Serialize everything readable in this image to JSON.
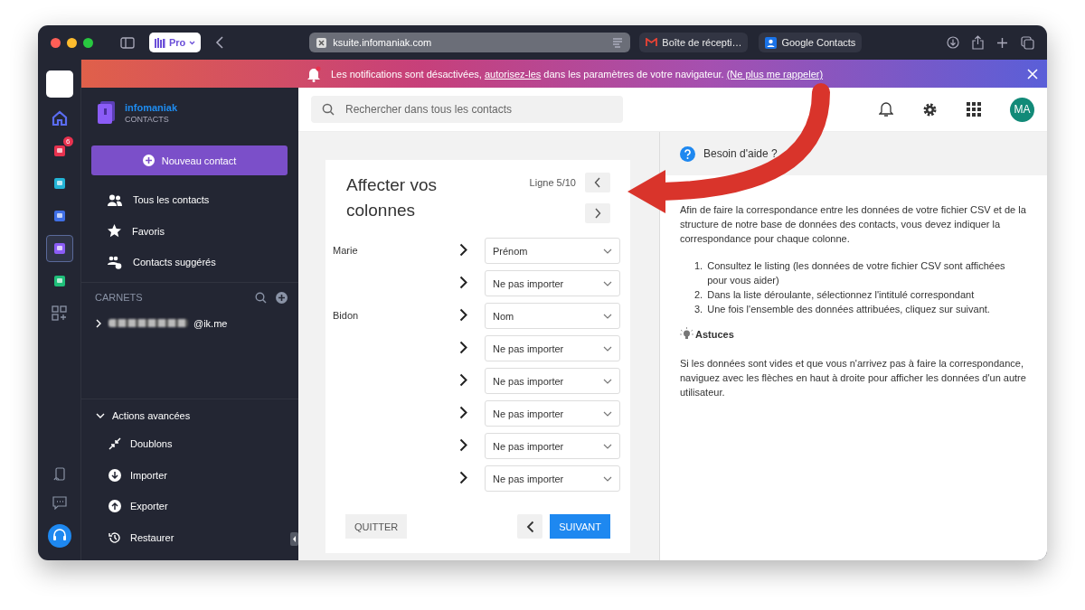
{
  "browser": {
    "profile": "Pro",
    "address": "ksuite.infomaniak.com",
    "tabs": [
      {
        "label": "Boîte de récepti…",
        "kind": "mail",
        "selected": false
      },
      {
        "label": "Google Contacts",
        "kind": "contacts",
        "selected": false
      }
    ]
  },
  "banner": {
    "before": "Les notifications sont désactivées, ",
    "link": "autorisez-les",
    "middle": " dans les paramètres de votre navigateur. ",
    "link2": "(Ne plus me rappeler)"
  },
  "rail": {
    "apps": [
      {
        "kind": "home",
        "selected": false
      },
      {
        "kind": "mail",
        "selected": false,
        "badge": "6"
      },
      {
        "kind": "drive",
        "selected": false
      },
      {
        "kind": "files",
        "selected": false
      },
      {
        "kind": "contacts",
        "selected": true
      },
      {
        "kind": "chat",
        "selected": false
      },
      {
        "kind": "add",
        "selected": false
      }
    ]
  },
  "sidebar": {
    "brand": "infomaniak",
    "product": "CONTACTS",
    "new_button": "Nouveau contact",
    "nav": [
      {
        "label": "Tous les contacts",
        "kind": "people"
      },
      {
        "label": "Favoris",
        "kind": "star"
      },
      {
        "label": "Contacts suggérés",
        "kind": "suggest"
      }
    ],
    "section": "CARNETS",
    "carnet": {
      "label": "@ik.me",
      "expanded": false
    },
    "advanced": {
      "label": "Actions avancées",
      "expanded": true,
      "items": [
        {
          "label": "Doublons",
          "kind": "merge"
        },
        {
          "label": "Importer",
          "kind": "down"
        },
        {
          "label": "Exporter",
          "kind": "up"
        },
        {
          "label": "Restaurer",
          "kind": "restore"
        }
      ]
    }
  },
  "topbar": {
    "search_placeholder": "Rechercher dans tous les contacts",
    "avatar": "MA"
  },
  "mapping": {
    "title": "Affecter vos colonnes",
    "line": "Ligne 5/10",
    "rows": [
      {
        "source": "Marie",
        "target": "Prénom"
      },
      {
        "target": "Ne pas importer"
      },
      {
        "source": "Bidon",
        "target": "Nom"
      },
      {
        "target": "Ne pas importer"
      },
      {
        "target": "Ne pas importer"
      },
      {
        "target": "Ne pas importer"
      },
      {
        "target": "Ne pas importer"
      },
      {
        "target": "Ne pas importer"
      }
    ],
    "quit": "QUITTER",
    "next": "SUIVANT"
  },
  "help": {
    "title": "Besoin d'aide ?",
    "intro": "Afin de faire la correspondance entre les données de votre fichier CSV et de la structure de notre base de données des contacts, vous devez indiquer la correspondance pour chaque colonne.",
    "steps": [
      {
        "number": "1.",
        "text": "Consultez le listing (les données de votre fichier CSV sont affichées pour vous aider)"
      },
      {
        "number": "2.",
        "text": "Dans la liste déroulante, sélectionnez l'intitulé correspondant"
      },
      {
        "number": "3.",
        "text": "Une fois l'ensemble des données attribuées, cliquez sur suivant."
      }
    ],
    "tips_title": "Astuces",
    "tips": "Si les données sont vides et que vous n'arrivez pas à faire la correspondance, naviguez avec les flèches en haut à droite pour afficher les données d'un autre utilisateur."
  }
}
